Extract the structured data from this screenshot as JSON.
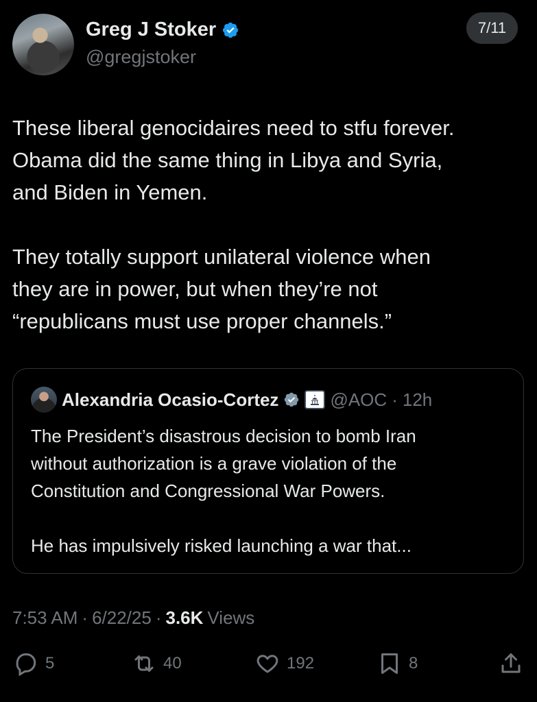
{
  "author": {
    "name": "Greg J Stoker",
    "handle": "@gregjstoker"
  },
  "thread_position": "7/11",
  "tweet": {
    "paragraphs": [
      [
        "These liberal genocidaires need to stfu forever.",
        "Obama did the same thing in Libya and Syria,",
        "and Biden in Yemen."
      ],
      [
        "They totally support unilateral violence when",
        "they are in power, but when they’re not",
        "“republicans must use proper channels.”"
      ]
    ]
  },
  "quote": {
    "name": "Alexandria Ocasio-Cortez",
    "handle": "@AOC",
    "separator": "·",
    "time": "12h",
    "lines": [
      "The President’s disastrous decision to bomb Iran",
      "without authorization is a grave violation of the",
      "Constitution and Congressional War Powers.",
      "",
      "He has impulsively risked launching a war that..."
    ]
  },
  "meta": {
    "time": "7:53 AM",
    "sep1": "·",
    "date": "6/22/25",
    "sep2": "·",
    "views_count": "3.6K",
    "views_label": "Views"
  },
  "actions": {
    "replies": "5",
    "reposts": "40",
    "likes": "192",
    "bookmarks": "8"
  },
  "icons": [
    "verified-badge-icon",
    "government-label-icon",
    "reply-icon",
    "repost-icon",
    "like-icon",
    "bookmark-icon",
    "share-icon"
  ],
  "colors": {
    "background": "#000000",
    "text": "#e7e9ea",
    "muted": "#71767b",
    "verified": "#1d9bf0",
    "border": "#2f3336"
  }
}
